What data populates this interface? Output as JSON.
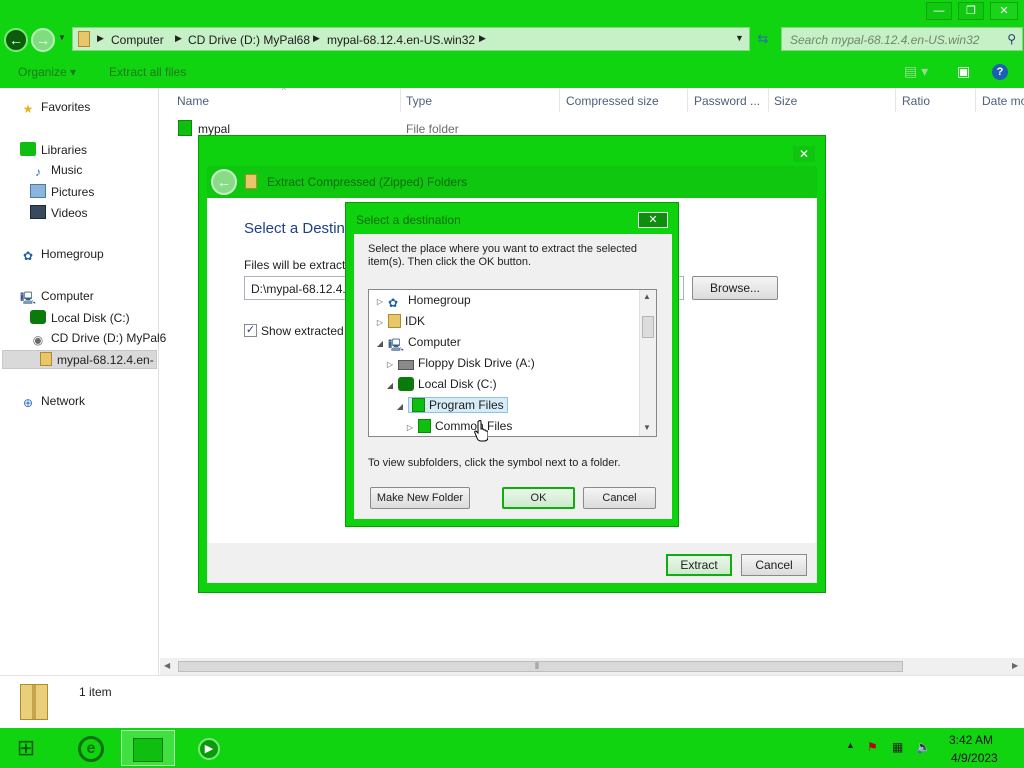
{
  "window": {
    "controls": {
      "minimize": "—",
      "maximize": "❐",
      "close": "✕"
    }
  },
  "address": {
    "crumbs": [
      "Computer",
      "CD Drive (D:) MyPal68",
      "mypal-68.12.4.en-US.win32"
    ],
    "search_placeholder": "Search mypal-68.12.4.en-US.win32"
  },
  "toolbar": {
    "organize": "Organize ▾",
    "extract_all": "Extract all files"
  },
  "nav": {
    "favorites": "Favorites",
    "libraries": "Libraries",
    "music": "Music",
    "pictures": "Pictures",
    "videos": "Videos",
    "homegroup": "Homegroup",
    "computer": "Computer",
    "local_disk": "Local Disk (C:)",
    "cd_drive": "CD Drive (D:) MyPal6",
    "mypal_folder": "mypal-68.12.4.en-",
    "network": "Network"
  },
  "columns": [
    "Name",
    "Type",
    "Compressed size",
    "Password ...",
    "Size",
    "Ratio",
    "Date mo"
  ],
  "files": [
    {
      "name": "mypal",
      "type": "File folder"
    }
  ],
  "status": {
    "count": "1 item"
  },
  "wizard": {
    "title": "Extract Compressed (Zipped) Folders",
    "heading": "Select a Destin",
    "files_label": "Files will be extracte",
    "path": "D:\\mypal-68.12.4.e",
    "browse": "Browse...",
    "show_label": "Show extracted f",
    "extract": "Extract",
    "cancel": "Cancel"
  },
  "dest": {
    "title": "Select a destination",
    "instructions": "Select the place where you want to extract the selected item(s).  Then click the OK button.",
    "tree": [
      {
        "label": "Homegroup",
        "expander": "▷"
      },
      {
        "label": "IDK",
        "expander": "▷"
      },
      {
        "label": "Computer",
        "expander": "◢"
      },
      {
        "label": "Floppy Disk Drive (A:)",
        "expander": "▷"
      },
      {
        "label": "Local Disk (C:)",
        "expander": "◢"
      },
      {
        "label": "Program Files",
        "expander": "◢"
      },
      {
        "label": "Common Files",
        "expander": "▷"
      }
    ],
    "hint": "To view subfolders, click the symbol next to a folder.",
    "make_new_folder": "Make New Folder",
    "ok": "OK",
    "cancel": "Cancel"
  },
  "clock": {
    "time": "3:42 AM",
    "date": "4/9/2023"
  }
}
